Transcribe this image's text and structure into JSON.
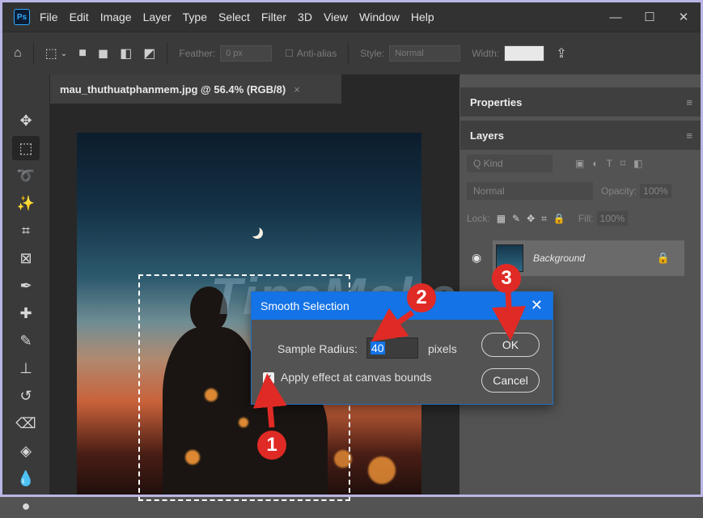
{
  "menubar": {
    "logo": "Ps",
    "items": [
      "File",
      "Edit",
      "Image",
      "Layer",
      "Type",
      "Select",
      "Filter",
      "3D",
      "View",
      "Window",
      "Help"
    ],
    "controls": {
      "minimize": "—",
      "maximize": "☐",
      "close": "✕"
    }
  },
  "options": {
    "feather_label": "Feather:",
    "feather_value": "0 px",
    "antialias_label": "Anti-alias",
    "style_label": "Style:",
    "style_value": "Normal",
    "width_label": "Width:"
  },
  "document": {
    "tab_title": "mau_thuthuatphanmem.jpg @ 56.4% (RGB/8)",
    "tab_close": "×",
    "watermark": "TipsMake"
  },
  "panels": {
    "properties": "Properties",
    "layers": "Layers",
    "kind_label": "Q Kind",
    "blend_mode": "Normal",
    "opacity_label": "Opacity:",
    "opacity_value": "100%",
    "lock_label": "Lock:",
    "fill_label": "Fill:",
    "fill_value": "100%",
    "layer_name": "Background"
  },
  "dialog": {
    "title": "Smooth Selection",
    "close": "✕",
    "sample_radius_label": "Sample Radius:",
    "sample_radius_value": "40",
    "unit": "pixels",
    "checkbox_label": "Apply effect at canvas bounds",
    "checkbox_checked": true,
    "ok_label": "OK",
    "cancel_label": "Cancel"
  },
  "callouts": [
    "1",
    "2",
    "3"
  ],
  "colors": {
    "accent": "#1473e6",
    "callout": "#e02a25"
  }
}
